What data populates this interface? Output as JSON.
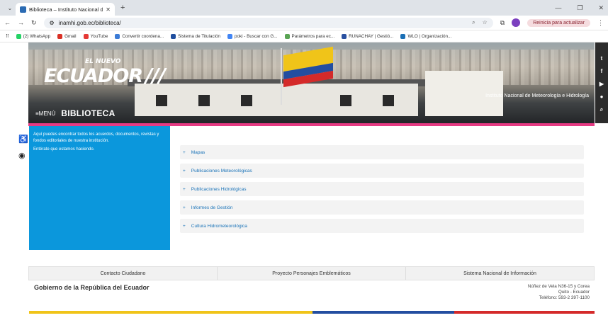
{
  "browser": {
    "tab_title": "Biblioteca – Instituto Nacional d",
    "url": "inamhi.gob.ec/biblioteca/",
    "update_label": "Reinicia para actualizar"
  },
  "bookmarks": [
    {
      "label": "(2) WhatsApp",
      "color": "#25d366"
    },
    {
      "label": "Gmail",
      "color": "#d93025"
    },
    {
      "label": "YouTube",
      "color": "#e53935"
    },
    {
      "label": "Convertir coordena...",
      "color": "#3b7bd6"
    },
    {
      "label": "Sistema de Titulación",
      "color": "#1f4e9e"
    },
    {
      "label": "poki - Buscar con G...",
      "color": "#4285f4"
    },
    {
      "label": "Parámetros para ec...",
      "color": "#5aa454"
    },
    {
      "label": "RUNACHAY | Gestió...",
      "color": "#2950a0"
    },
    {
      "label": "WLO | Organización...",
      "color": "#1a6fb5"
    }
  ],
  "header": {
    "logo_small": "EL NUEVO",
    "logo_text": "ECUADOR",
    "institute": "Instituto Nacional de Meteorología e Hidrología",
    "menu_label": "≡MENÚ",
    "page_title": "BIBLIOTECA"
  },
  "sidebar": {
    "intro": "Aquí puedes encontrar todos los acuerdos, documentos, revistas y fondos editoriales de nuestra institución.",
    "note": "Entérate que estamos haciendo."
  },
  "sections": [
    {
      "label": "Mapas"
    },
    {
      "label": "Publicaciones Meteorológicas"
    },
    {
      "label": "Publicaciones Hidrológicas"
    },
    {
      "label": "Informes de Gestión"
    },
    {
      "label": "Cultura Hidrometeorológica"
    }
  ],
  "footer": {
    "links": [
      "Contacto Ciudadano",
      "Proyecto Personajes Emblemáticos",
      "Sistema Nacional de Información"
    ],
    "gov": "Gobierno de la República del Ecuador",
    "address1": "Núñez de Vela N36-15 y Corea",
    "address2": "Quito - Ecuador",
    "phone": "Teléfono: 593-2 397-1100"
  },
  "colors": {
    "accent_blue": "#0b97dc",
    "pink": "#e63a83"
  }
}
